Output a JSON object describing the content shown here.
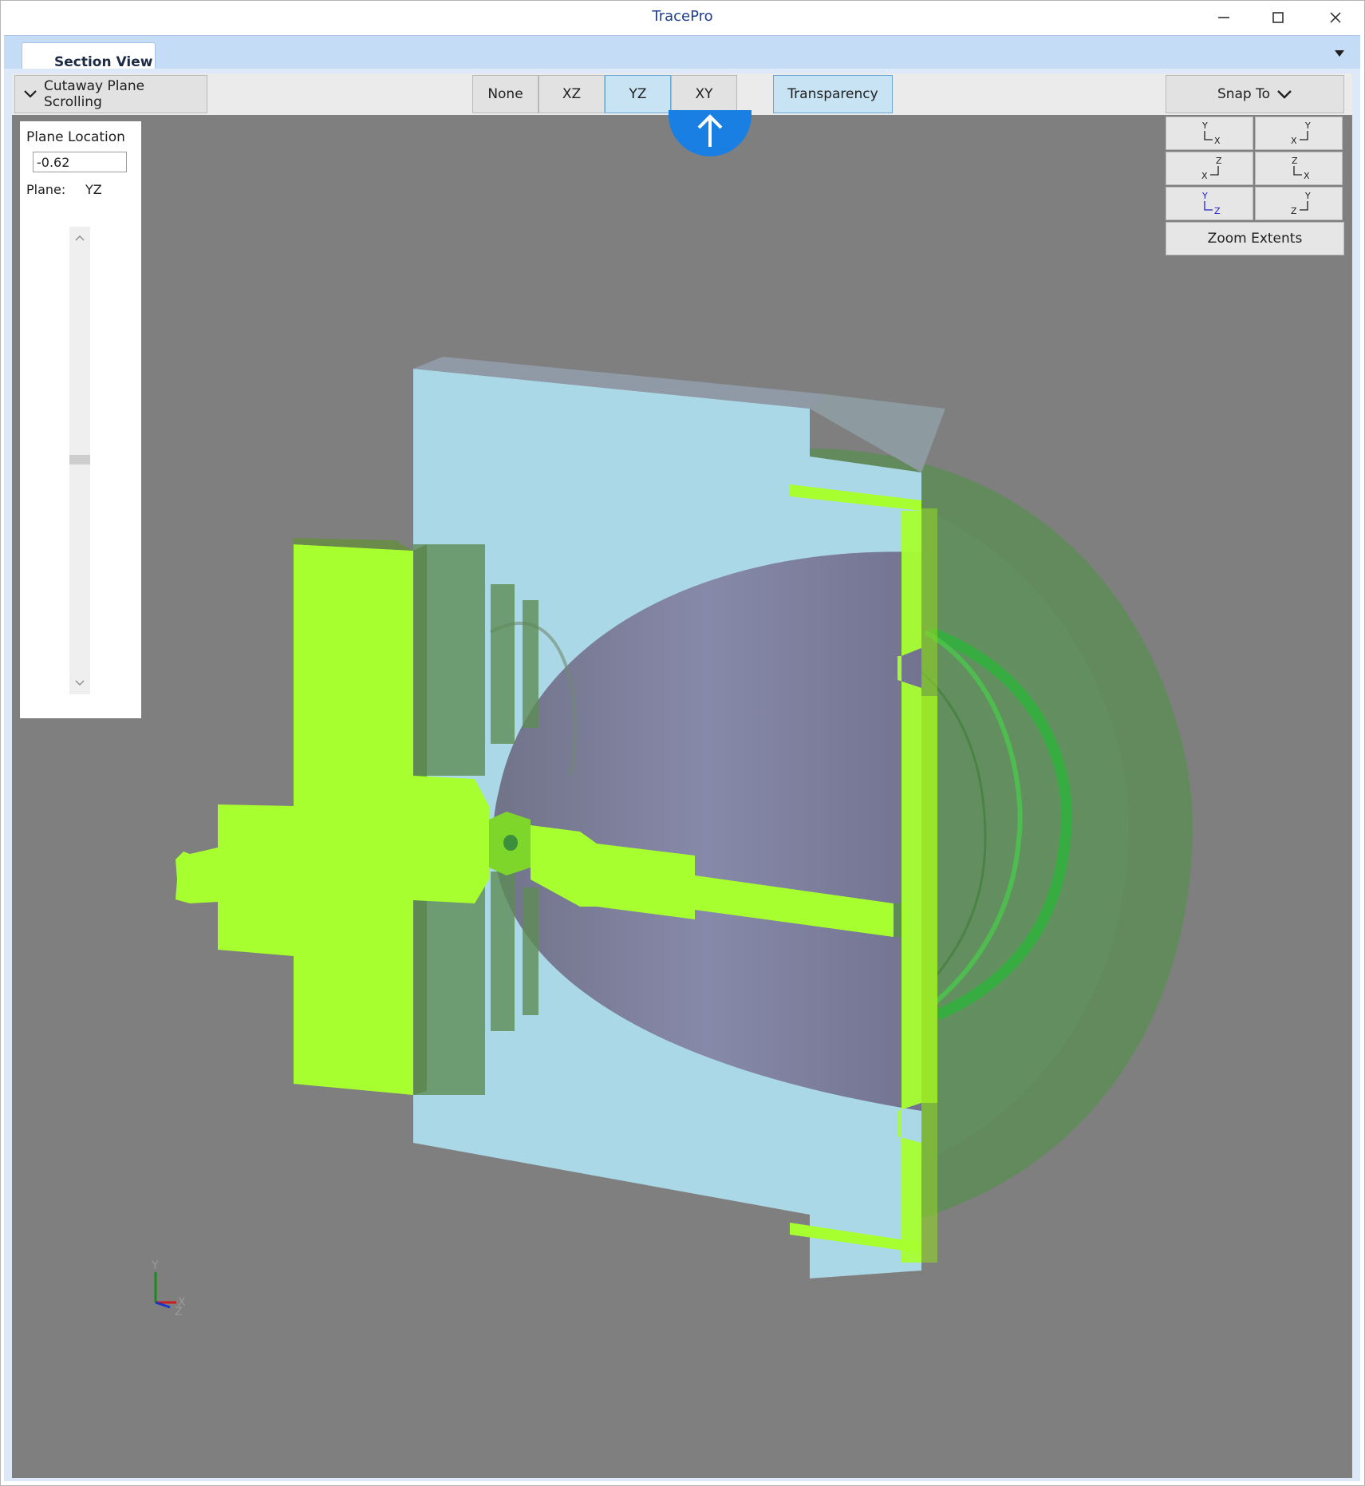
{
  "window": {
    "title": "TracePro"
  },
  "tabs": [
    {
      "label": "Section View"
    }
  ],
  "toolbar": {
    "cutaway_label": "Cutaway Plane Scrolling",
    "plane_buttons": [
      "None",
      "XZ",
      "YZ",
      "XY"
    ],
    "active_plane": "YZ",
    "transparency_label": "Transparency",
    "transparency_on": true,
    "snap_to_label": "Snap To"
  },
  "snap_views": [
    {
      "vertical": "Y",
      "horizontal": "X",
      "active": false
    },
    {
      "vertical": "Y",
      "horizontal": "X",
      "active": false
    },
    {
      "vertical": "Z",
      "horizontal": "X",
      "active": false
    },
    {
      "vertical": "Z",
      "horizontal": "X",
      "active": false
    },
    {
      "vertical": "Y",
      "horizontal": "Z",
      "active": true
    },
    {
      "vertical": "Y",
      "horizontal": "Z",
      "active": false
    }
  ],
  "zoom_extents_label": "Zoom Extents",
  "cutaway_panel": {
    "plane_location_label": "Plane Location",
    "plane_location_value": "-0.62",
    "plane_label": "Plane:",
    "plane_value": "YZ"
  },
  "axis_triad": {
    "labels": [
      "Y",
      "X",
      "Z"
    ]
  },
  "colors": {
    "viewport": "#7f7f7f",
    "section_fill": "#a8ff30",
    "mount_plate": "#acd8e6",
    "reflector": "#7d7d9c",
    "lens": "#5b8a57",
    "accent": "#1a7fe3"
  },
  "icons": {
    "minimize": "minimize-icon",
    "maximize": "maximize-icon",
    "close": "close-icon",
    "up_arrow": "arrow-up-icon",
    "chevron": "chevron-down-icon"
  }
}
